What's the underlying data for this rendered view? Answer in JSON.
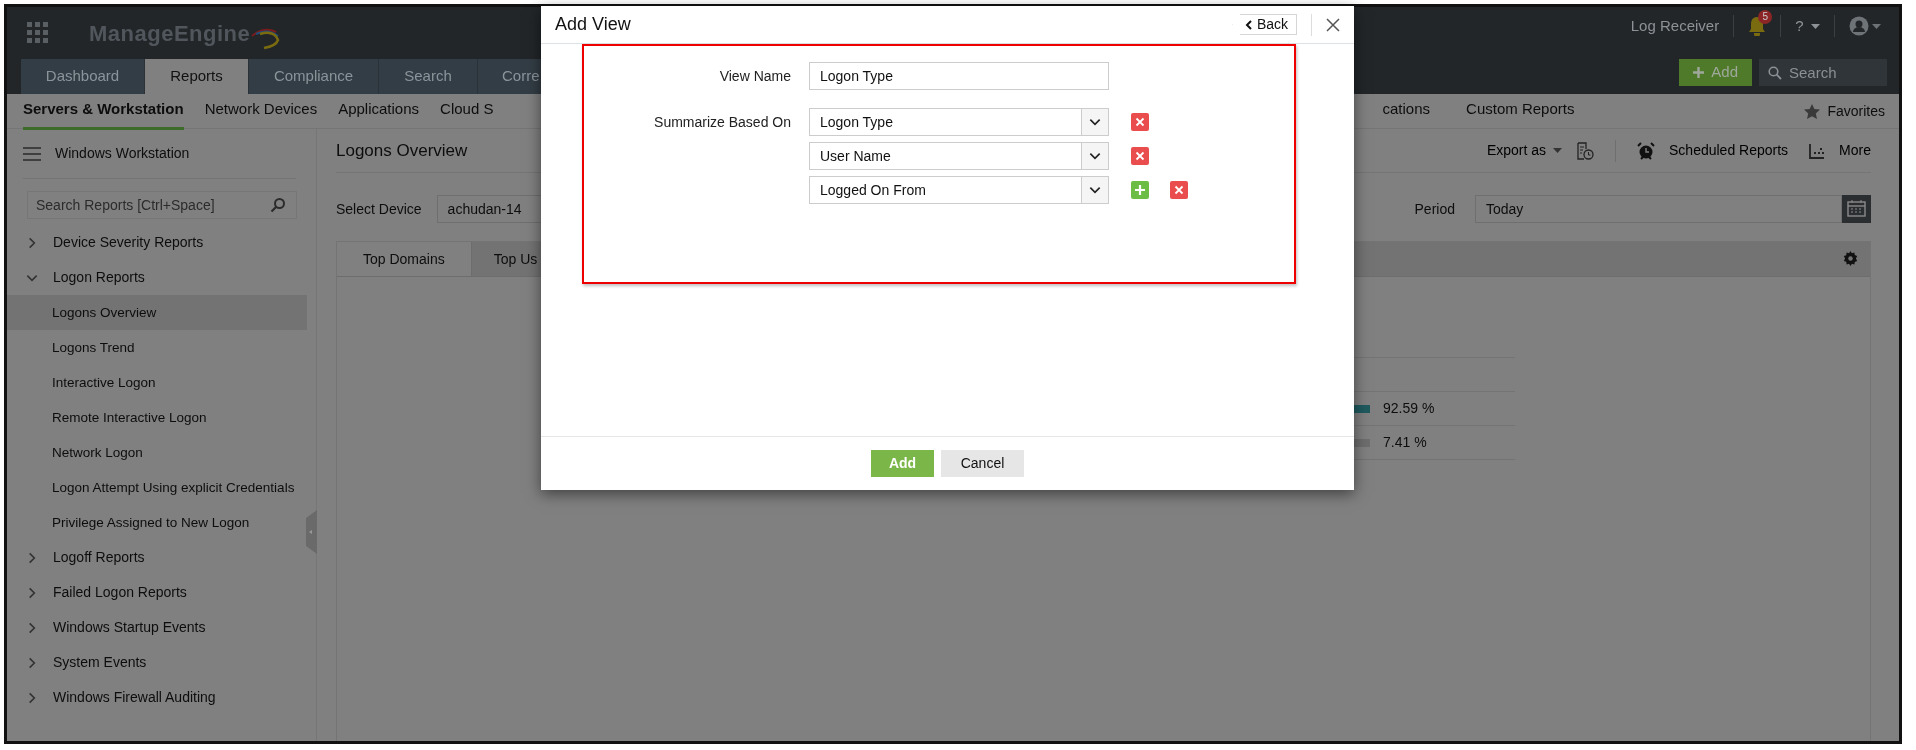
{
  "header": {
    "logo": "ManageEngine",
    "log_receiver": "Log Receiver",
    "notification_count": "5",
    "help": "?",
    "add_button": "Add",
    "search_placeholder": "Search"
  },
  "main_tabs": [
    {
      "label": "Dashboard",
      "selected": false
    },
    {
      "label": "Reports",
      "selected": true
    },
    {
      "label": "Compliance",
      "selected": false
    },
    {
      "label": "Search",
      "selected": false
    },
    {
      "label": "Corre",
      "selected": false
    }
  ],
  "sub_nav": {
    "left": [
      {
        "label": "Servers & Workstation",
        "selected": true
      },
      {
        "label": "Network Devices",
        "selected": false
      },
      {
        "label": "Applications",
        "selected": false
      },
      {
        "label": "Cloud S",
        "selected": false
      }
    ],
    "right": [
      {
        "label": "cations",
        "selected": false
      },
      {
        "label": "Custom Reports",
        "selected": false
      }
    ],
    "favorites": "Favorites"
  },
  "sidebar": {
    "title": "Windows Workstation",
    "search_placeholder": "Search Reports [Ctrl+Space]",
    "items": [
      {
        "label": "Device Severity Reports",
        "expanded": false
      },
      {
        "label": "Logon Reports",
        "expanded": true,
        "children": [
          {
            "label": "Logons Overview",
            "selected": true
          },
          {
            "label": "Logons Trend",
            "selected": false
          },
          {
            "label": "Interactive Logon",
            "selected": false
          },
          {
            "label": "Remote Interactive Logon",
            "selected": false
          },
          {
            "label": "Network Logon",
            "selected": false
          },
          {
            "label": "Logon Attempt Using explicit Credentials",
            "selected": false
          },
          {
            "label": "Privilege Assigned to New Logon",
            "selected": false
          }
        ]
      },
      {
        "label": "Logoff Reports",
        "expanded": false
      },
      {
        "label": "Failed Logon Reports",
        "expanded": false
      },
      {
        "label": "Windows Startup Events",
        "expanded": false
      },
      {
        "label": "System Events",
        "expanded": false
      },
      {
        "label": "Windows Firewall Auditing",
        "expanded": false
      }
    ]
  },
  "content": {
    "title": "Logons Overview",
    "export": "Export as",
    "scheduled": "Scheduled Reports",
    "more": "More",
    "select_device_label": "Select Device",
    "device": "achudan-14",
    "period_label": "Period",
    "period": "Today",
    "tabs": [
      {
        "label": "Top Domains",
        "selected": true
      },
      {
        "label": "Top Us",
        "selected": false
      }
    ],
    "rows": [
      {
        "value": "92.59 %",
        "color": "#1f5a5f"
      },
      {
        "value": "7.41 %",
        "color": "#6e6e6e"
      }
    ]
  },
  "dialog": {
    "title": "Add View",
    "back": "Back",
    "highlighted": true,
    "view_name_label": "View Name",
    "view_name": "Logon Type",
    "summarize_label": "Summarize Based On",
    "fields": [
      {
        "value": "Logon Type",
        "can_add": false
      },
      {
        "value": "User Name",
        "can_add": false
      },
      {
        "value": "Logged On From",
        "can_add": true
      }
    ],
    "buttons": [
      {
        "label": "Add",
        "kind": "primary"
      },
      {
        "label": "Cancel",
        "kind": "secondary"
      }
    ]
  }
}
